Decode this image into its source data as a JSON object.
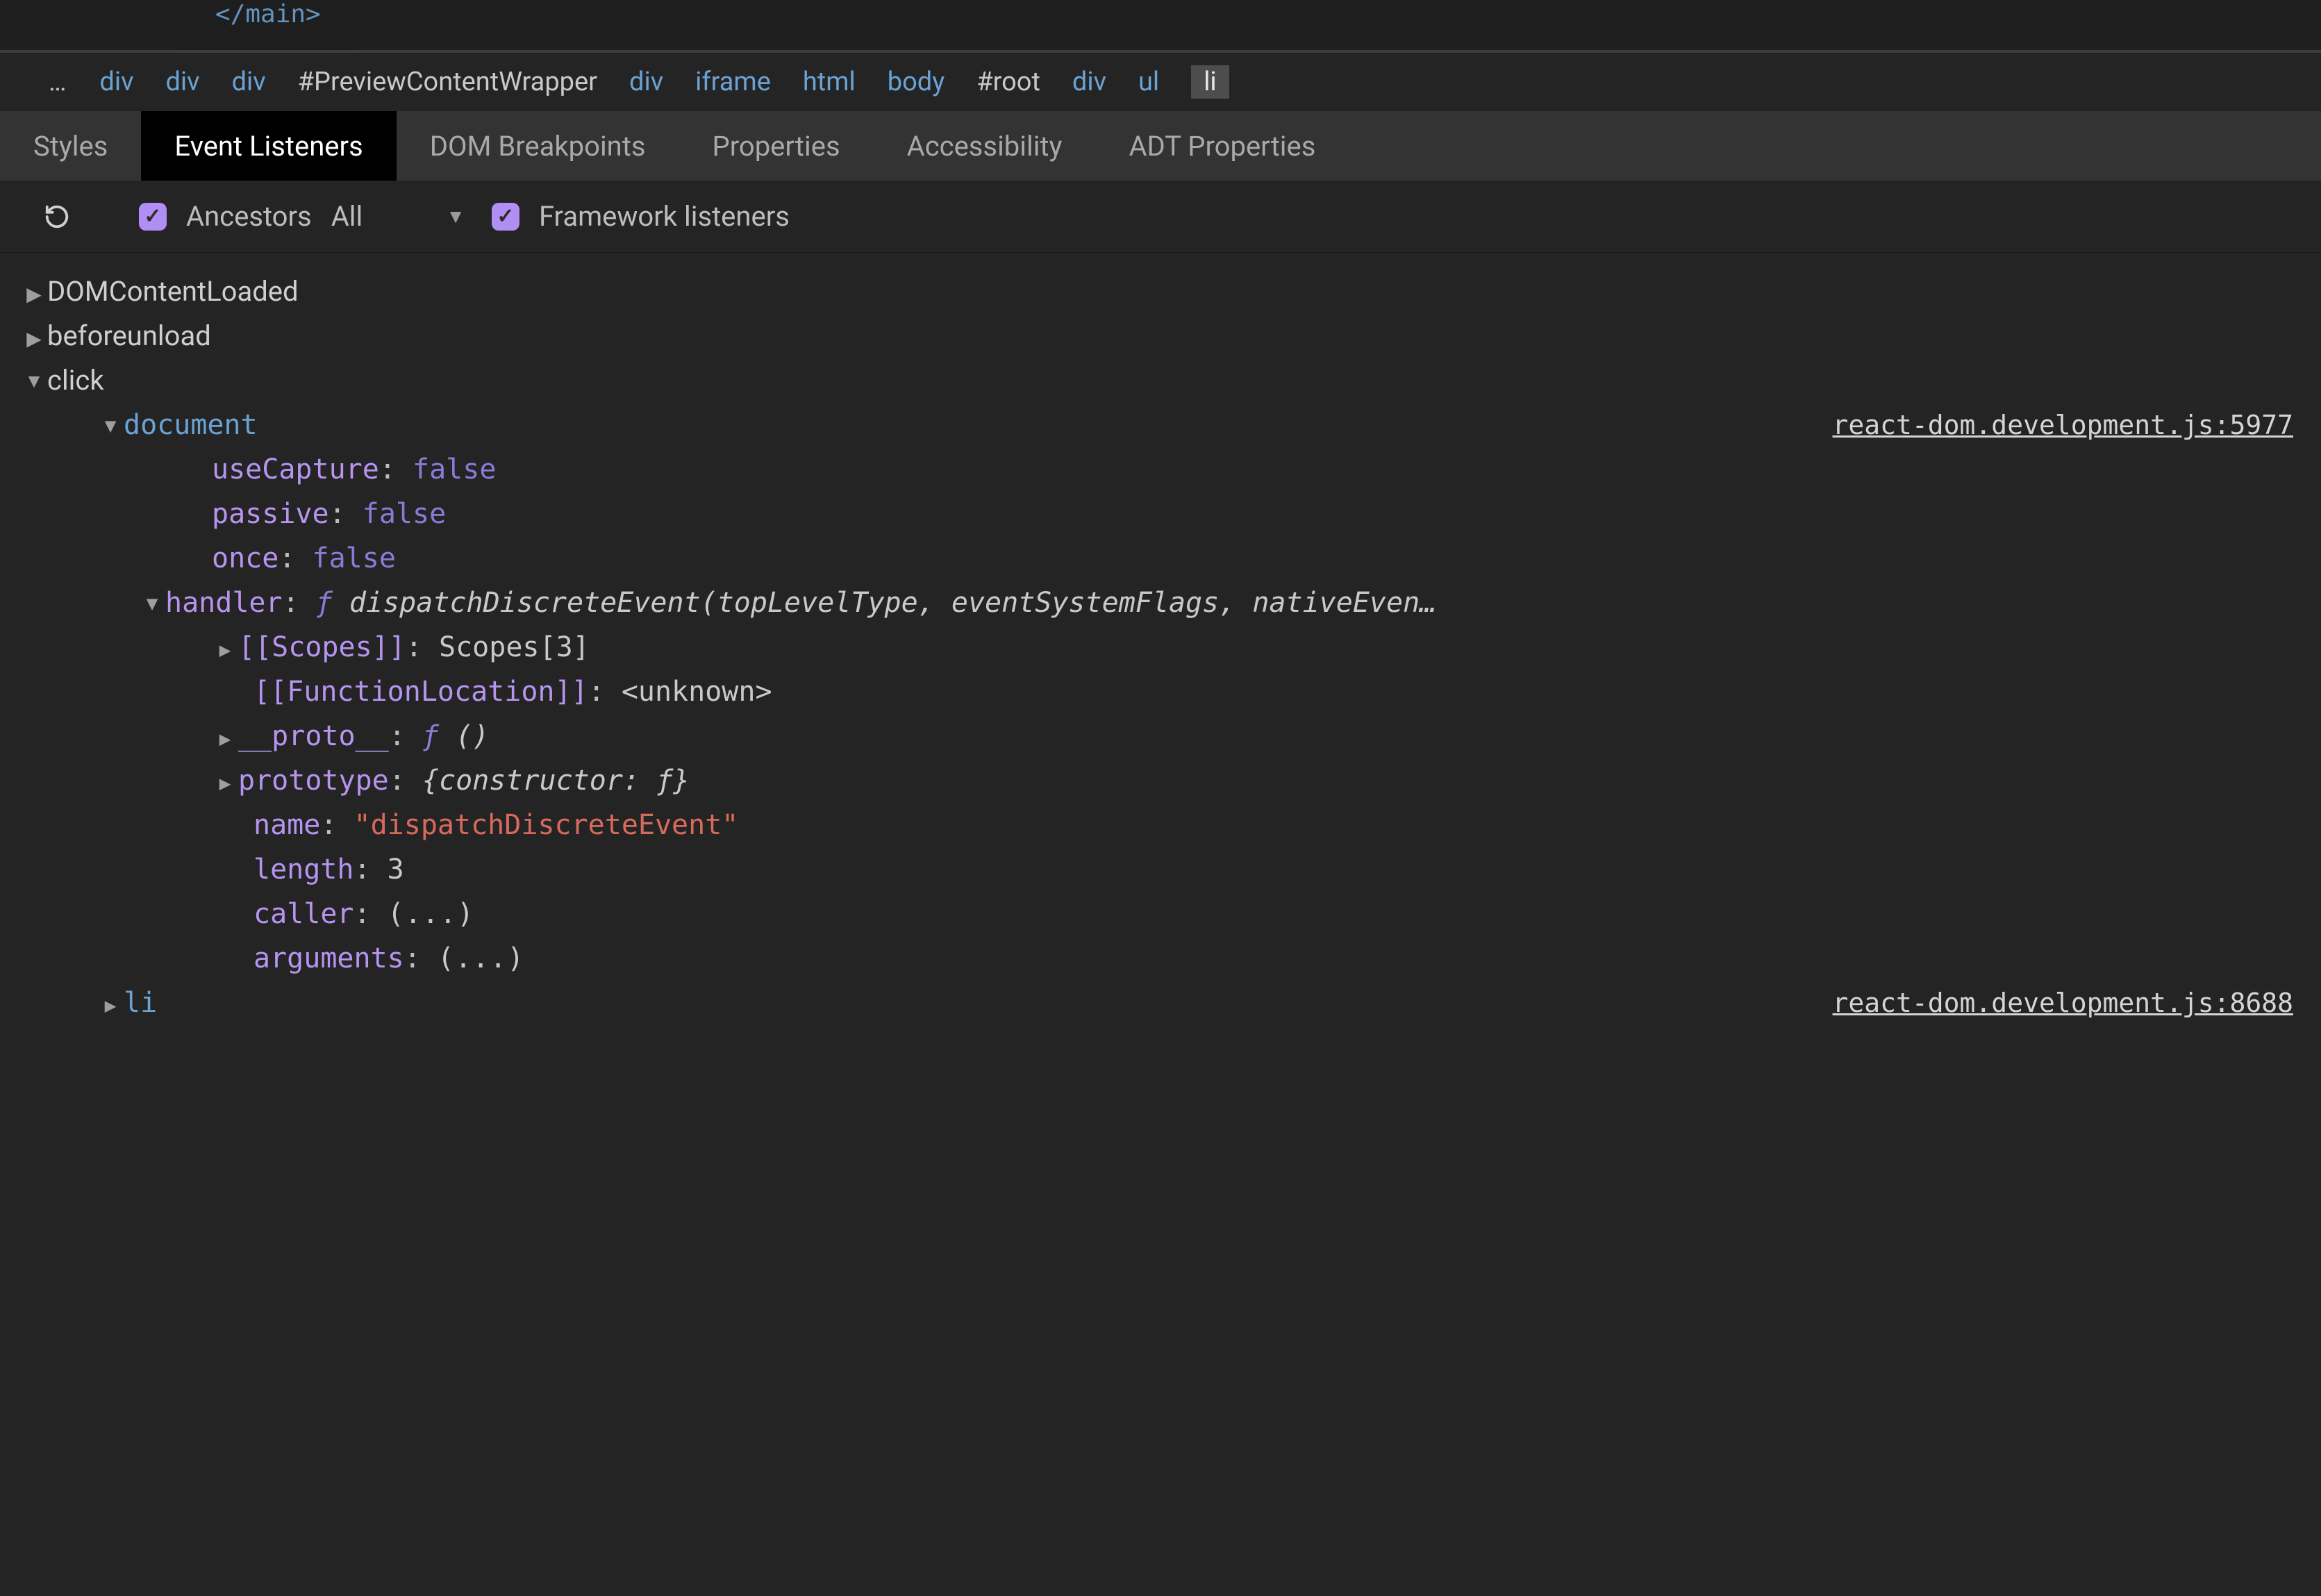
{
  "source_strip": "</main>",
  "breadcrumb": {
    "dots": "…",
    "items": [
      {
        "t": "div",
        "cls": "el"
      },
      {
        "t": "div",
        "cls": "el"
      },
      {
        "t": "div",
        "cls": "el"
      },
      {
        "t": "#PreviewContentWrapper",
        "cls": "el id"
      },
      {
        "t": "div",
        "cls": "el"
      },
      {
        "t": "iframe",
        "cls": "el"
      },
      {
        "t": "html",
        "cls": "el"
      },
      {
        "t": "body",
        "cls": "el"
      },
      {
        "t": "#root",
        "cls": "el id"
      },
      {
        "t": "div",
        "cls": "el"
      },
      {
        "t": "ul",
        "cls": "el"
      },
      {
        "t": "li",
        "cls": "el current"
      }
    ]
  },
  "tabs": [
    {
      "label": "Styles",
      "active": false
    },
    {
      "label": "Event Listeners",
      "active": true
    },
    {
      "label": "DOM Breakpoints",
      "active": false
    },
    {
      "label": "Properties",
      "active": false
    },
    {
      "label": "Accessibility",
      "active": false
    },
    {
      "label": "ADT Properties",
      "active": false
    }
  ],
  "toolbar": {
    "ancestors_label": "Ancestors",
    "filter_value": "All",
    "framework_label": "Framework listeners",
    "ancestors_checked": true,
    "framework_checked": true
  },
  "events": {
    "e0": "DOMContentLoaded",
    "e1": "beforeunload",
    "e2": "click"
  },
  "click": {
    "target0": "document",
    "target0_link": "react-dom.development.js:5977",
    "props": {
      "useCapture_k": "useCapture",
      "useCapture_v": "false",
      "passive_k": "passive",
      "passive_v": "false",
      "once_k": "once",
      "once_v": "false",
      "handler_k": "handler",
      "handler_f": "ƒ ",
      "handler_sig": "dispatchDiscreteEvent(topLevelType, eventSystemFlags, nativeEven…",
      "scopes_k": "[[Scopes]]",
      "scopes_v": "Scopes[3]",
      "funcloc_k": "[[FunctionLocation]]",
      "funcloc_v": "<unknown>",
      "proto_k": "__proto__",
      "proto_f": "ƒ ",
      "proto_v": "()",
      "prototype_k": "prototype",
      "prototype_v": "{constructor: ƒ}",
      "name_k": "name",
      "name_v": "\"dispatchDiscreteEvent\"",
      "length_k": "length",
      "length_v": "3",
      "caller_k": "caller",
      "caller_v": "(...)",
      "arguments_k": "arguments",
      "arguments_v": "(...)"
    },
    "target1": "li",
    "target1_link": "react-dom.development.js:8688"
  }
}
